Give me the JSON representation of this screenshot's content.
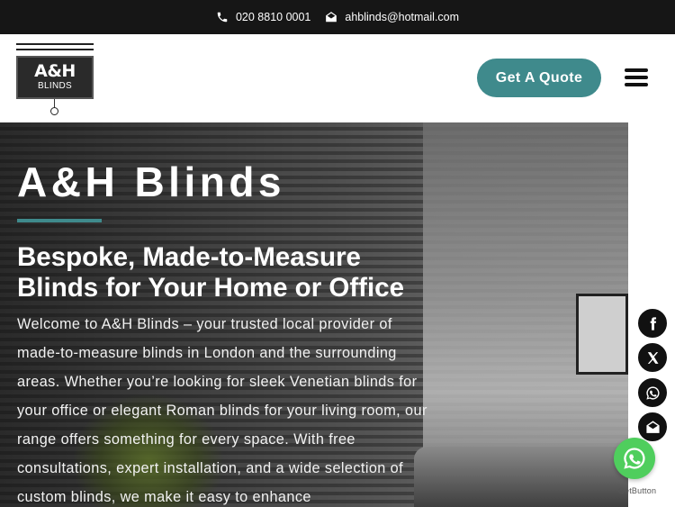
{
  "topbar": {
    "phone": "020 8810 0001",
    "email": "ahblinds@hotmail.com",
    "phone_icon": "phone-icon",
    "email_icon": "envelope-icon"
  },
  "logo": {
    "brand": "A&H",
    "sub": "BLINDS"
  },
  "header": {
    "cta_label": "Get A Quote",
    "menu_icon": "hamburger-icon"
  },
  "hero": {
    "title": "A&H Blinds",
    "subtitle": "Bespoke, Made-to-Measure Blinds for Your Home or Office",
    "body": "Welcome to A&H Blinds – your trusted local provider of made-to-measure blinds in London and the surrounding areas. Whether you’re looking for sleek Venetian blinds for your office or elegant Roman blinds for your living room, our range offers something for every space. With free consultations, expert installation, and a wide selection of custom blinds, we make it easy to enhance"
  },
  "social": [
    "facebook-icon",
    "x-icon",
    "whatsapp-icon",
    "email-icon"
  ],
  "floating": {
    "whatsapp_icon": "whatsapp-icon",
    "credit": "GetButton"
  },
  "colors": {
    "accent": "#3f8a8c",
    "topbar": "#161616",
    "whatsapp": "#4fce5d"
  }
}
